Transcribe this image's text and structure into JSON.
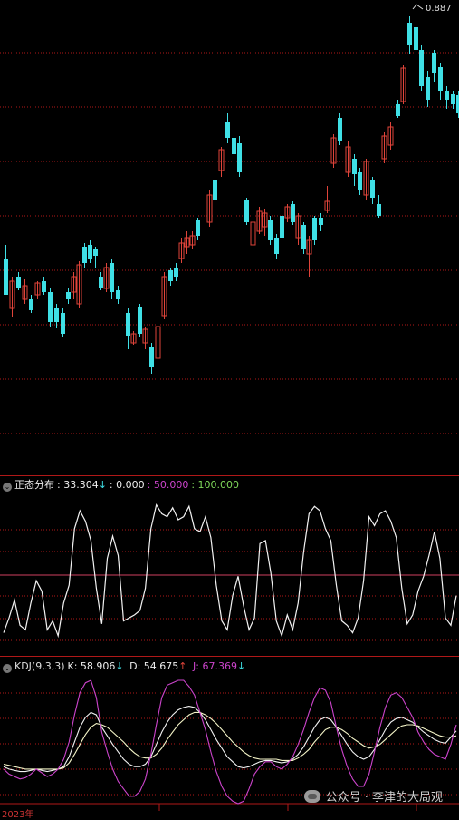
{
  "main_chart": {
    "price_label": "0.887"
  },
  "indicator1": {
    "name": "正态分布",
    "value": ": 33.304",
    "value_arrow": "↓",
    "v2": ": 0.000",
    "v3": ": 50.000",
    "v4": ": 100.000"
  },
  "indicator2": {
    "name": "KDJ(9,3,3)",
    "k": "K: 58.906",
    "k_arrow": "↓",
    "d": "D: 54.675",
    "d_arrow": "↑",
    "j": "J: 67.369",
    "j_arrow": "↓"
  },
  "x_axis": {
    "year_label": "2023年"
  },
  "watermark": {
    "text": "公众号 · 李津的大局观"
  },
  "colors": {
    "up": "#e0443a",
    "down": "#3fe0e6",
    "grid": "#b01818",
    "white": "#f2f2f2",
    "magenta": "#cc44cc",
    "green": "#7fd85a"
  },
  "chart_data": [
    {
      "type": "line",
      "title": "正态分布",
      "ylim": [
        0,
        100
      ],
      "series": [
        {
          "name": "正态分布",
          "values": [
            10,
            20,
            32,
            15,
            12,
            30,
            45,
            38,
            12,
            18,
            8,
            30,
            42,
            80,
            92,
            85,
            72,
            40,
            16,
            60,
            75,
            62,
            18,
            20,
            22,
            25,
            40,
            80,
            96,
            90,
            88,
            94,
            86,
            88,
            95,
            80,
            78,
            88,
            74,
            42,
            18,
            12,
            35,
            48,
            28,
            12,
            20,
            70,
            72,
            50,
            18,
            8,
            22,
            12,
            30,
            64,
            90,
            95,
            92,
            80,
            72,
            42,
            18,
            15,
            10,
            20,
            45,
            88,
            82,
            90,
            92,
            85,
            74,
            40,
            16,
            22,
            38,
            48,
            62,
            78,
            60,
            20,
            15,
            35
          ]
        }
      ]
    },
    {
      "type": "line",
      "title": "KDJ(9,3,3)",
      "series": [
        {
          "name": "K",
          "values": [
            30,
            28,
            27,
            26,
            26,
            27,
            28,
            27,
            26,
            27,
            28,
            30,
            38,
            50,
            62,
            70,
            74,
            72,
            62,
            55,
            48,
            42,
            36,
            32,
            30,
            30,
            32,
            38,
            48,
            58,
            66,
            72,
            76,
            78,
            79,
            78,
            74,
            68,
            60,
            52,
            45,
            38,
            34,
            30,
            29,
            30,
            32,
            34,
            35,
            35,
            34,
            33,
            34,
            36,
            40,
            46,
            54,
            62,
            68,
            70,
            68,
            62,
            55,
            48,
            42,
            38,
            36,
            38,
            44,
            52,
            60,
            66,
            69,
            70,
            68,
            66,
            62,
            58,
            55,
            52,
            50,
            49,
            54,
            59
          ]
        },
        {
          "name": "D",
          "values": [
            32,
            31,
            30,
            29,
            28,
            28,
            28,
            28,
            28,
            28,
            28,
            29,
            33,
            40,
            48,
            56,
            62,
            65,
            64,
            62,
            58,
            54,
            50,
            45,
            41,
            38,
            37,
            37,
            40,
            45,
            52,
            58,
            64,
            68,
            72,
            74,
            74,
            72,
            69,
            65,
            60,
            55,
            50,
            46,
            42,
            39,
            37,
            36,
            36,
            36,
            36,
            35,
            35,
            35,
            37,
            40,
            44,
            50,
            55,
            60,
            62,
            62,
            60,
            57,
            53,
            50,
            47,
            45,
            46,
            48,
            52,
            56,
            60,
            63,
            64,
            64,
            63,
            61,
            59,
            57,
            55,
            54,
            54,
            55
          ]
        },
        {
          "name": "J",
          "values": [
            28,
            24,
            22,
            20,
            21,
            24,
            28,
            25,
            22,
            24,
            28,
            36,
            50,
            72,
            90,
            98,
            100,
            86,
            58,
            42,
            28,
            18,
            12,
            6,
            6,
            10,
            20,
            40,
            64,
            86,
            96,
            98,
            100,
            100,
            95,
            88,
            74,
            60,
            42,
            26,
            14,
            6,
            2,
            0,
            2,
            12,
            24,
            30,
            34,
            34,
            30,
            28,
            32,
            38,
            48,
            60,
            74,
            86,
            94,
            92,
            82,
            62,
            44,
            30,
            20,
            14,
            14,
            24,
            42,
            62,
            78,
            88,
            90,
            86,
            78,
            70,
            58,
            50,
            44,
            40,
            38,
            36,
            48,
            64
          ]
        }
      ]
    }
  ]
}
